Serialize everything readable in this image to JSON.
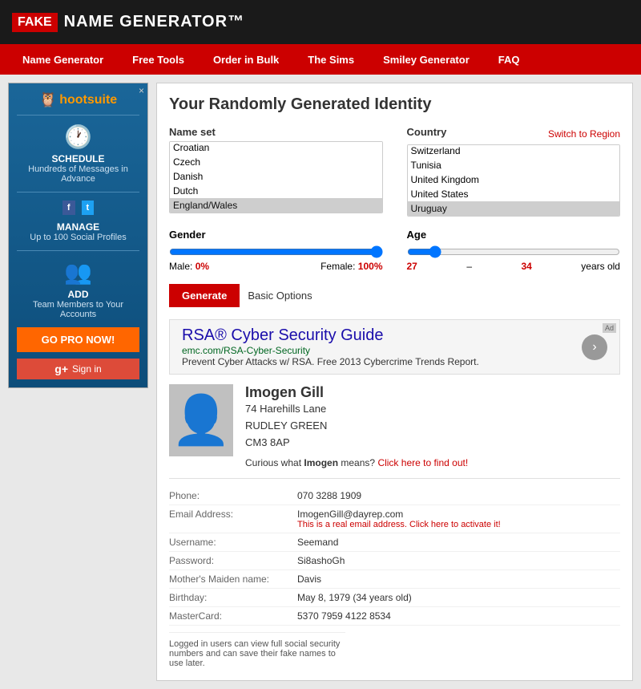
{
  "header": {
    "fake_label": "FAKE",
    "name_gen_label": "NAME GENERATOR",
    "tm": "™"
  },
  "nav": {
    "items": [
      {
        "label": "Name Generator",
        "id": "nav-name-generator"
      },
      {
        "label": "Free Tools",
        "id": "nav-free-tools"
      },
      {
        "label": "Order in Bulk",
        "id": "nav-order-bulk"
      },
      {
        "label": "The Sims",
        "id": "nav-the-sims"
      },
      {
        "label": "Smiley Generator",
        "id": "nav-smiley-generator"
      },
      {
        "label": "FAQ",
        "id": "nav-faq"
      }
    ]
  },
  "sidebar": {
    "brand": "hootsuite",
    "close_label": "×",
    "schedule_title": "SCHEDULE",
    "schedule_desc": "Hundreds of Messages in Advance",
    "manage_title": "MANAGE",
    "manage_desc": "Up to 100 Social Profiles",
    "add_title": "ADD",
    "add_desc": "Team Members to Your Accounts",
    "go_pro_label": "GO PRO NOW!",
    "signin_label": "Sign in"
  },
  "form": {
    "title": "Your Randomly Generated Identity",
    "name_set_label": "Name set",
    "country_label": "Country",
    "switch_label": "Switch to Region",
    "name_options": [
      {
        "value": "croatian",
        "label": "Croatian"
      },
      {
        "value": "czech",
        "label": "Czech"
      },
      {
        "value": "danish",
        "label": "Danish"
      },
      {
        "value": "dutch",
        "label": "Dutch"
      },
      {
        "value": "england_wales",
        "label": "England/Wales",
        "selected": true
      }
    ],
    "country_options": [
      {
        "value": "switzerland",
        "label": "Switzerland"
      },
      {
        "value": "tunisia",
        "label": "Tunisia"
      },
      {
        "value": "united_kingdom",
        "label": "United Kingdom",
        "selected": true
      },
      {
        "value": "united_states",
        "label": "United States"
      },
      {
        "value": "uruguay",
        "label": "Uruguay",
        "selected": true
      }
    ],
    "gender_label": "Gender",
    "age_label": "Age",
    "male_label": "Male:",
    "male_value": "0%",
    "female_label": "Female:",
    "female_value": "100%",
    "age_min": "27",
    "age_max": "34",
    "age_suffix": "years old",
    "generate_label": "Generate",
    "basic_options_label": "Basic Options"
  },
  "ad": {
    "title": "RSA® Cyber Security Guide",
    "url": "emc.com/RSA-Cyber-Security",
    "description": "Prevent Cyber Attacks w/ RSA. Free 2013 Cybercrime Trends Report."
  },
  "profile": {
    "name": "Imogen Gill",
    "address_line1": "74 Harehills Lane",
    "address_line2": "RUDLEY GREEN",
    "address_line3": "CM3 8AP",
    "name_meaning_prefix": "Curious what",
    "name_meaning_name": "Imogen",
    "name_meaning_suffix": "means?",
    "name_meaning_link": "Click here to find out!",
    "phone_label": "Phone:",
    "phone_value": "070 3288 1909",
    "email_label": "Email Address:",
    "email_value": "ImogenGill@dayrep.com",
    "email_sub": "This is a real email address. Click here to activate it!",
    "username_label": "Username:",
    "username_value": "Seemand",
    "password_label": "Password:",
    "password_value": "Si8ashoGh",
    "maiden_label": "Mother's Maiden name:",
    "maiden_value": "Davis",
    "birthday_label": "Birthday:",
    "birthday_value": "May 8, 1979 (34 years old)",
    "mastercard_label": "MasterCard:",
    "mastercard_value": "5370 7959 4122 8534",
    "logged_in_note": "Logged in users can view full social security numbers and can save their fake names to use later."
  }
}
